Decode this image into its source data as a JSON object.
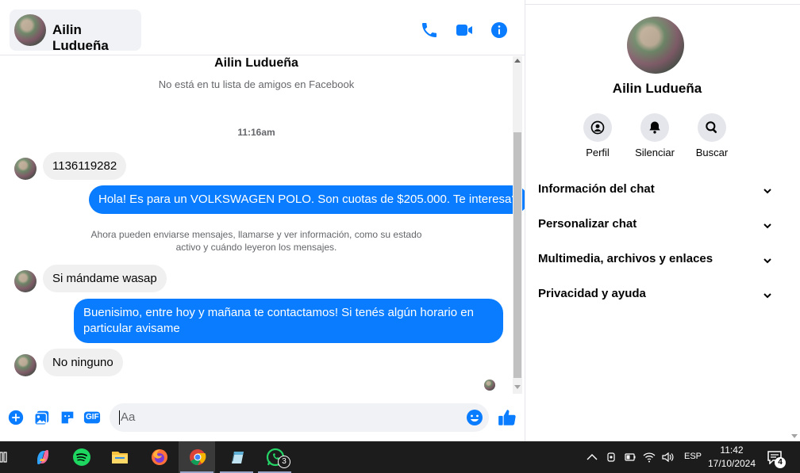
{
  "header": {
    "contact_name": "Ailin Ludueña",
    "icons": [
      "phone-icon",
      "video-icon",
      "info-icon"
    ]
  },
  "conversation": {
    "intro_name": "Ailin Ludueña",
    "intro_subtitle": "No está en tu lista de amigos en Facebook",
    "timestamp": "11:16am",
    "messages": [
      {
        "from": "contact",
        "text": "1136119282"
      },
      {
        "from": "me",
        "text": "Hola! Es para un VOLKSWAGEN POLO. Son cuotas de $205.000. Te interesa?"
      },
      {
        "from": "system",
        "text": "Ahora pueden enviarse mensajes, llamarse y ver información, como su estado activo y cuándo leyeron los mensajes."
      },
      {
        "from": "contact",
        "text": "Si mándame wasap"
      },
      {
        "from": "me",
        "text": "Buenisimo, entre hoy y mañana te contactamos! Si tenés algún horario en particular avisame"
      },
      {
        "from": "contact",
        "text": "No ninguno"
      }
    ]
  },
  "composer": {
    "placeholder": "Aa",
    "icons": [
      "plus-icon",
      "image-icon",
      "sticker-icon",
      "gif-icon",
      "emoji-icon",
      "like-icon"
    ],
    "gif_label": "GIF"
  },
  "panel": {
    "name": "Ailin Ludueña",
    "actions": [
      {
        "label": "Perfil",
        "icon": "profile-icon"
      },
      {
        "label": "Silenciar",
        "icon": "bell-icon"
      },
      {
        "label": "Buscar",
        "icon": "search-icon"
      }
    ],
    "sections": [
      "Información del chat",
      "Personalizar chat",
      "Multimedia, archivos y enlaces",
      "Privacidad y ayuda"
    ]
  },
  "taskbar": {
    "apps": [
      "copilot-icon",
      "spotify-icon",
      "file-explorer-icon",
      "firefox-icon",
      "chrome-icon",
      "notes-icon",
      "whatsapp-icon"
    ],
    "whatsapp_badge": "3",
    "language": "ESP",
    "time": "11:42",
    "date": "17/10/2024",
    "notification_count": "4"
  },
  "colors": {
    "accent": "#0a7cff",
    "incoming_bubble": "#f0f0f0",
    "taskbar": "#1c1c1c"
  }
}
